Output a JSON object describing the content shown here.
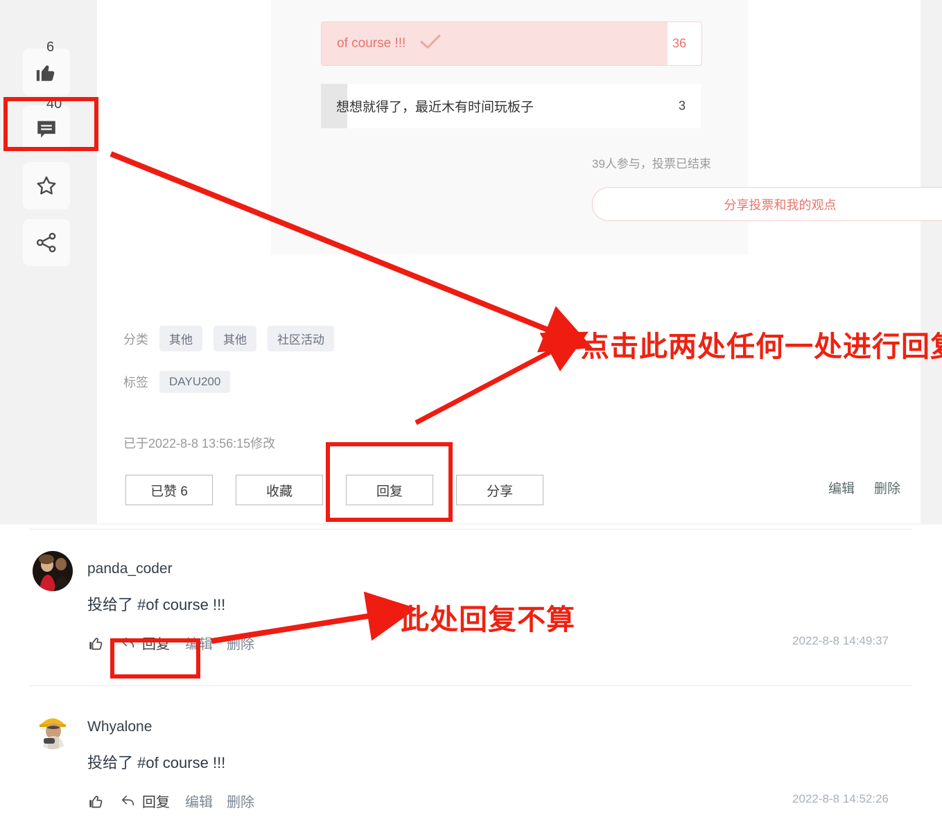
{
  "rail": [
    {
      "name": "like",
      "icon": "thumbs-up-icon",
      "count": "6"
    },
    {
      "name": "comment",
      "icon": "comment-icon",
      "count": "40"
    },
    {
      "name": "favorite",
      "icon": "star-icon",
      "count": ""
    },
    {
      "name": "share",
      "icon": "share-icon",
      "count": ""
    }
  ],
  "poll": {
    "options": [
      {
        "label": "of course !!!",
        "count": "36",
        "percent": 91,
        "voted": true
      },
      {
        "label": "想想就得了，最近木有时间玩板子",
        "count": "3",
        "percent": 7,
        "voted": false
      }
    ],
    "meta": "39人参与，投票已结束",
    "share_button": "分享投票和我的观点"
  },
  "meta": {
    "category_label": "分类",
    "categories": [
      "其他",
      "其他",
      "社区活动"
    ],
    "tag_label": "标签",
    "tags": [
      "DAYU200"
    ],
    "modified": "已于2022-8-8 13:56:15修改"
  },
  "actions": {
    "buttons": [
      "已赞 6",
      "收藏",
      "回复",
      "分享"
    ],
    "owner": [
      "编辑",
      "删除"
    ]
  },
  "comments": [
    {
      "user": "panda_coder",
      "body": "投给了 #of course !!!",
      "reply": "回复",
      "edit": "编辑",
      "delete": "删除",
      "time": "2022-8-8 14:49:37"
    },
    {
      "user": "Whyalone",
      "body": "投给了 #of course !!!",
      "reply": "回复",
      "edit": "编辑",
      "delete": "删除",
      "time": "2022-8-8 14:52:26"
    }
  ],
  "annotations": {
    "primary": "点击此两处任何一处进行回复",
    "secondary": "此处回复不算",
    "color": "#ee1c11"
  }
}
